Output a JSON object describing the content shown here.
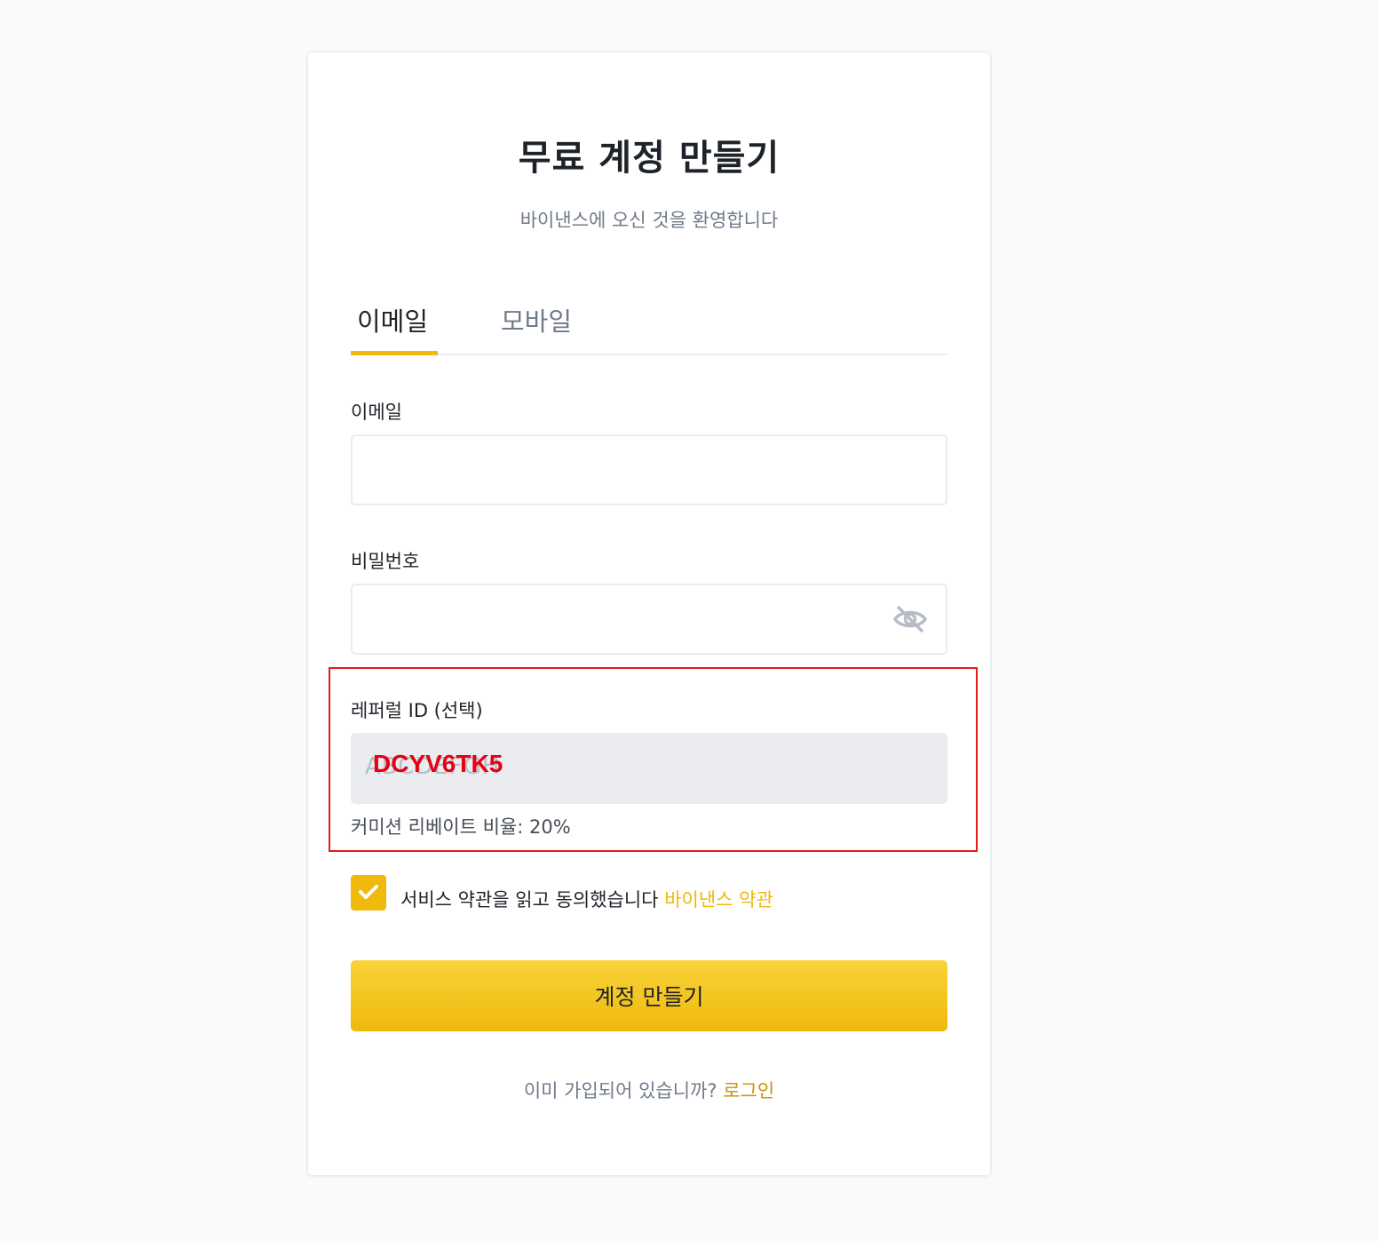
{
  "header": {
    "title": "무료 계정 만들기",
    "subtitle": "바이낸스에 오신 것을 환영합니다"
  },
  "tabs": [
    {
      "label": "이메일",
      "active": true
    },
    {
      "label": "모바일",
      "active": false
    }
  ],
  "form": {
    "email_label": "이메일",
    "email_value": "",
    "password_label": "비밀번호",
    "password_value": "",
    "password_toggle_icon": "eye-off-icon",
    "referral_label": "레퍼럴 ID (선택)",
    "referral_placeholder": "ABCDEFGH",
    "referral_code": "DCYV6TK5",
    "rebate_text": "커미션 리베이트 비율: 20%",
    "terms_text": "서비스 약관을 읽고 동의했습니다",
    "terms_link": "바이낸스 약관",
    "terms_checked": true,
    "submit_label": "계정 만들기"
  },
  "footer": {
    "login_prompt": "이미 가입되어 있습니까?",
    "login_link": "로그인"
  },
  "colors": {
    "accent": "#f0b90b",
    "highlight_frame": "#e31a1a",
    "referral_code": "#e60012",
    "background": "#fafafa"
  }
}
